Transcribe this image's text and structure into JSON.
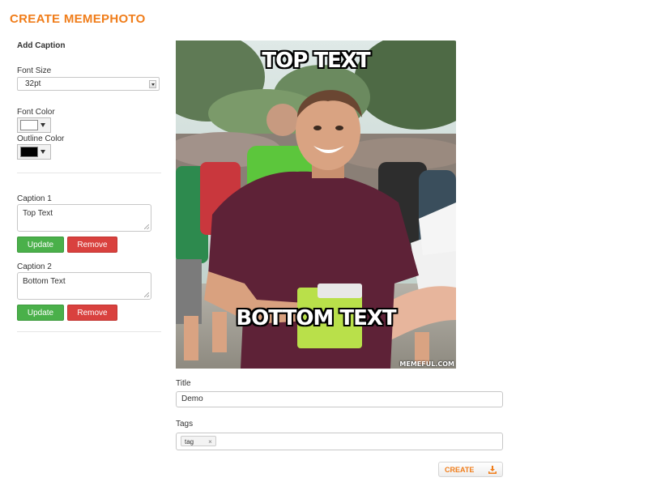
{
  "app": {
    "title": "CREATE MEMEPHOTO"
  },
  "sidebar": {
    "heading": "Add Caption",
    "font_size": {
      "label": "Font Size",
      "value": "32pt"
    },
    "font_color": {
      "label": "Font Color",
      "value": "#ffffff"
    },
    "outline_color": {
      "label": "Outline Color",
      "value": "#000000"
    },
    "captions": [
      {
        "label": "Caption 1",
        "value": "Top Text",
        "update_label": "Update",
        "remove_label": "Remove"
      },
      {
        "label": "Caption 2",
        "value": "Bottom Text",
        "update_label": "Update",
        "remove_label": "Remove"
      }
    ]
  },
  "meme": {
    "top_text": "TOP TEXT",
    "bottom_text": "BOTTOM TEXT",
    "watermark": "MEMEFUL.COM"
  },
  "form": {
    "title_label": "Title",
    "title_value": "Demo",
    "tags_label": "Tags",
    "tags": [
      "tag"
    ],
    "tag_remove_glyph": "×",
    "create_label": "CREATE"
  },
  "colors": {
    "accent": "#f07d1a",
    "update_button": "#4ab04a",
    "remove_button": "#d9413e"
  },
  "icons": {
    "create": "download-icon",
    "select": "chevron-down-icon"
  }
}
